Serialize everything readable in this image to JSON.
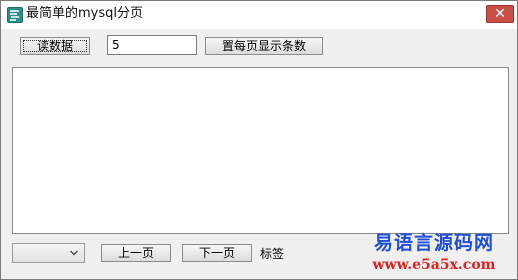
{
  "window": {
    "title": "最简单的mysql分页",
    "close_label": "✕"
  },
  "toolbar": {
    "read_data_label": "读数据",
    "per_page_value": "5",
    "set_per_page_label": "置每页显示条数"
  },
  "results": {
    "content": ""
  },
  "pager": {
    "page_select_value": "",
    "prev_label": "上一页",
    "next_label": "下一页",
    "tag_label": "标签"
  },
  "watermark": {
    "line1": "易语言源码网",
    "line2": "www.e5a5x.com"
  },
  "icons": {
    "app": "app-icon",
    "close": "close-icon",
    "dropdown": "chevron-down-icon"
  },
  "colors": {
    "close_button": "#c94f47",
    "watermark_blue": "#1f4fd6",
    "watermark_red": "#e02020",
    "window_bg": "#f0f0f0"
  }
}
